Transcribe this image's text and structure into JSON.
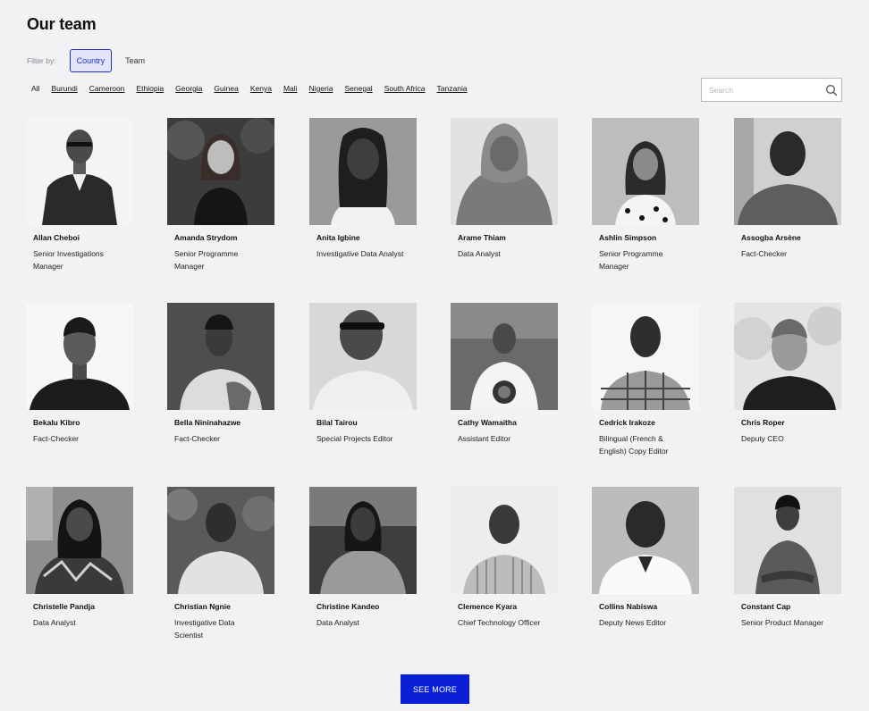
{
  "title": "Our team",
  "filter": {
    "label": "Filter by:",
    "options": [
      "Country",
      "Team"
    ]
  },
  "countries": [
    "All",
    "Burundi",
    "Cameroon",
    "Ethiopia",
    "Georgia",
    "Guinea",
    "Kenya",
    "Mali",
    "Nigeria",
    "Senegal",
    "South Africa",
    "Tanzania"
  ],
  "search": {
    "placeholder": "Search",
    "icon": "search-icon"
  },
  "members": [
    {
      "name": "Allan Cheboi",
      "role": "Senior Investigations Manager"
    },
    {
      "name": "Amanda Strydom",
      "role": "Senior Programme Manager"
    },
    {
      "name": "Anita Igbine",
      "role": "Investigative Data Analyst"
    },
    {
      "name": "Arame Thiam",
      "role": "Data Analyst"
    },
    {
      "name": "Ashlin Simpson",
      "role": "Senior Programme Manager"
    },
    {
      "name": "Assogba Arsène",
      "role": "Fact-Checker"
    },
    {
      "name": "Bekalu Kibro",
      "role": "Fact-Checker"
    },
    {
      "name": "Bella Nininahazwe",
      "role": "Fact-Checker"
    },
    {
      "name": "Bilal Tairou",
      "role": "Special Projects Editor"
    },
    {
      "name": "Cathy Wamaitha",
      "role": "Assistant Editor"
    },
    {
      "name": "Cedrick Irakoze",
      "role": "Bilingual (French & English) Copy Editor"
    },
    {
      "name": "Chris Roper",
      "role": "Deputy CEO"
    },
    {
      "name": "Christelle Pandja",
      "role": "Data Analyst"
    },
    {
      "name": "Christian Ngnie",
      "role": "Investigative Data Scientist"
    },
    {
      "name": "Christine Kandeo",
      "role": "Data Analyst"
    },
    {
      "name": "Clemence Kyara",
      "role": "Chief Technology Officer"
    },
    {
      "name": "Collins Nabiswa",
      "role": "Deputy News Editor"
    },
    {
      "name": "Constant Cap",
      "role": "Senior Product Manager"
    }
  ],
  "see_more_label": "SEE MORE",
  "colors": {
    "accent": "#0a1fd8",
    "active_filter_bg": "#e3e6fb",
    "background": "#f2f1f3"
  }
}
